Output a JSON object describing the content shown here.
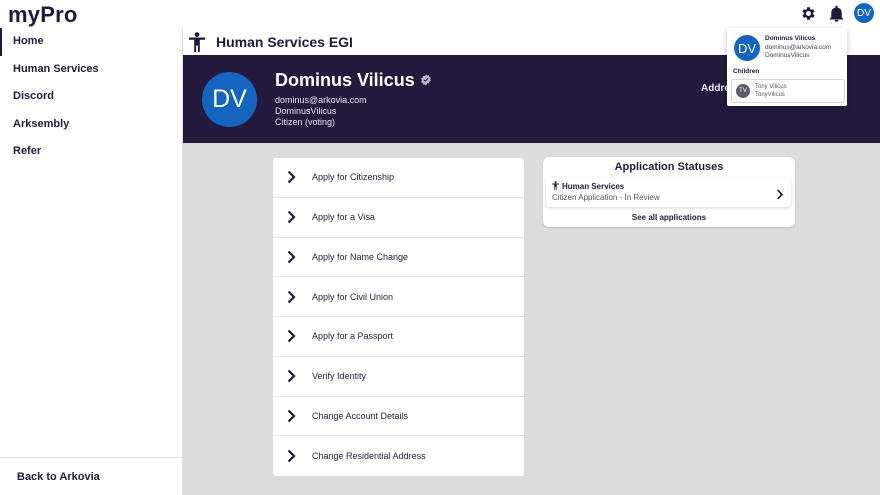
{
  "app": {
    "logo": "myPro"
  },
  "topbar": {
    "icons": [
      "gear-icon",
      "bell-icon"
    ],
    "avatar_initials": "DV"
  },
  "sidebar": {
    "items": [
      {
        "label": "Home",
        "active": true
      },
      {
        "label": "Human Services"
      },
      {
        "label": "Discord"
      },
      {
        "label": "Arksembly"
      },
      {
        "label": "Refer"
      }
    ],
    "footer": "Back to Arkovia"
  },
  "page": {
    "title": "Human Services EGI",
    "icon": "person-icon"
  },
  "profile": {
    "initials": "DV",
    "name": "Dominus Vilicus",
    "email": "dominus@arkovia.com",
    "username": "DominusVilicus",
    "status": "Citizen (voting)",
    "address_label": "Addre"
  },
  "actions": [
    "Apply for Citizenship",
    "Apply for a Visa",
    "Apply for Name Change",
    "Apply for Civil Union",
    "Apply for a Passport",
    "Verify Identity",
    "Change Account Details",
    "Change Residential Address"
  ],
  "applications": {
    "title": "Application Statuses",
    "item": {
      "title": "Human Services",
      "type": "Citizen Application",
      "status": "In Review"
    },
    "see_all": "See all applications"
  },
  "account_menu": {
    "initials": "DV",
    "name": "Dominus Vilicus",
    "email": "dominus@arkovia.com",
    "username": "DominusVilicus",
    "children_label": "Children",
    "child": {
      "initials": "TV",
      "name": "Tony Vilicus",
      "username": "TonyVilicus"
    }
  },
  "colors": {
    "banner": "#231a3d",
    "avatar": "#1565c0",
    "text_dark": "#1e1b3a",
    "background": "#dcdcdc"
  }
}
